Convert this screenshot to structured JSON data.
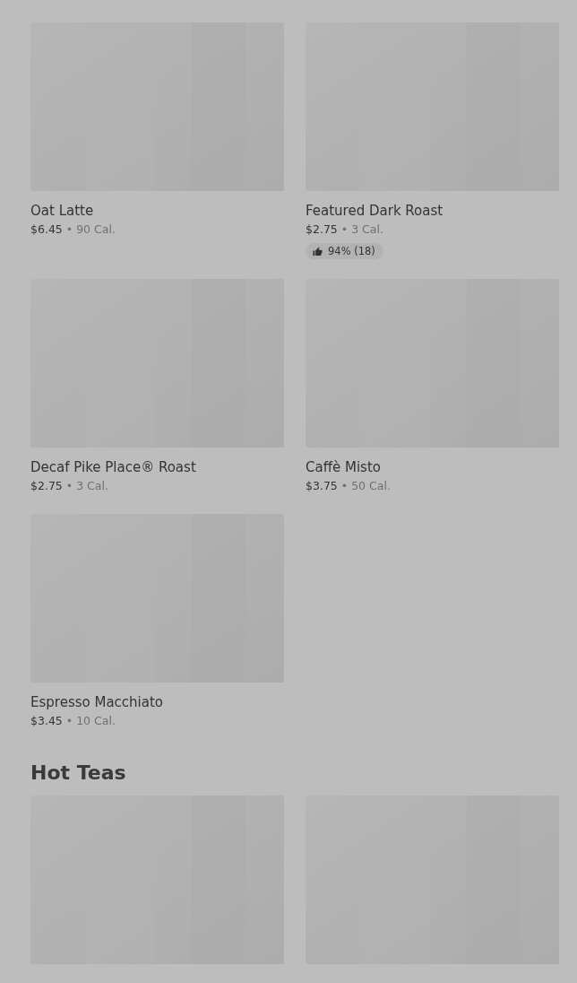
{
  "sections": [
    {
      "items": [
        {
          "kind": "product",
          "name": "Oat Latte",
          "price": "$6.45",
          "separator": "•",
          "calories": "90 Cal."
        },
        {
          "kind": "product",
          "name": "Featured Dark Roast",
          "price": "$2.75",
          "separator": "•",
          "calories": "3 Cal.",
          "rating": "94% (18)"
        },
        {
          "kind": "product",
          "name": "Decaf Pike Place® Roast",
          "price": "$2.75",
          "separator": "•",
          "calories": "3 Cal."
        },
        {
          "kind": "product",
          "name": "Caffè Misto",
          "price": "$3.75",
          "separator": "•",
          "calories": "50 Cal."
        },
        {
          "kind": "product",
          "name": "Espresso Macchiato",
          "price": "$3.45",
          "separator": "•",
          "calories": "10 Cal."
        }
      ]
    },
    {
      "title": "Hot Teas"
    }
  ]
}
